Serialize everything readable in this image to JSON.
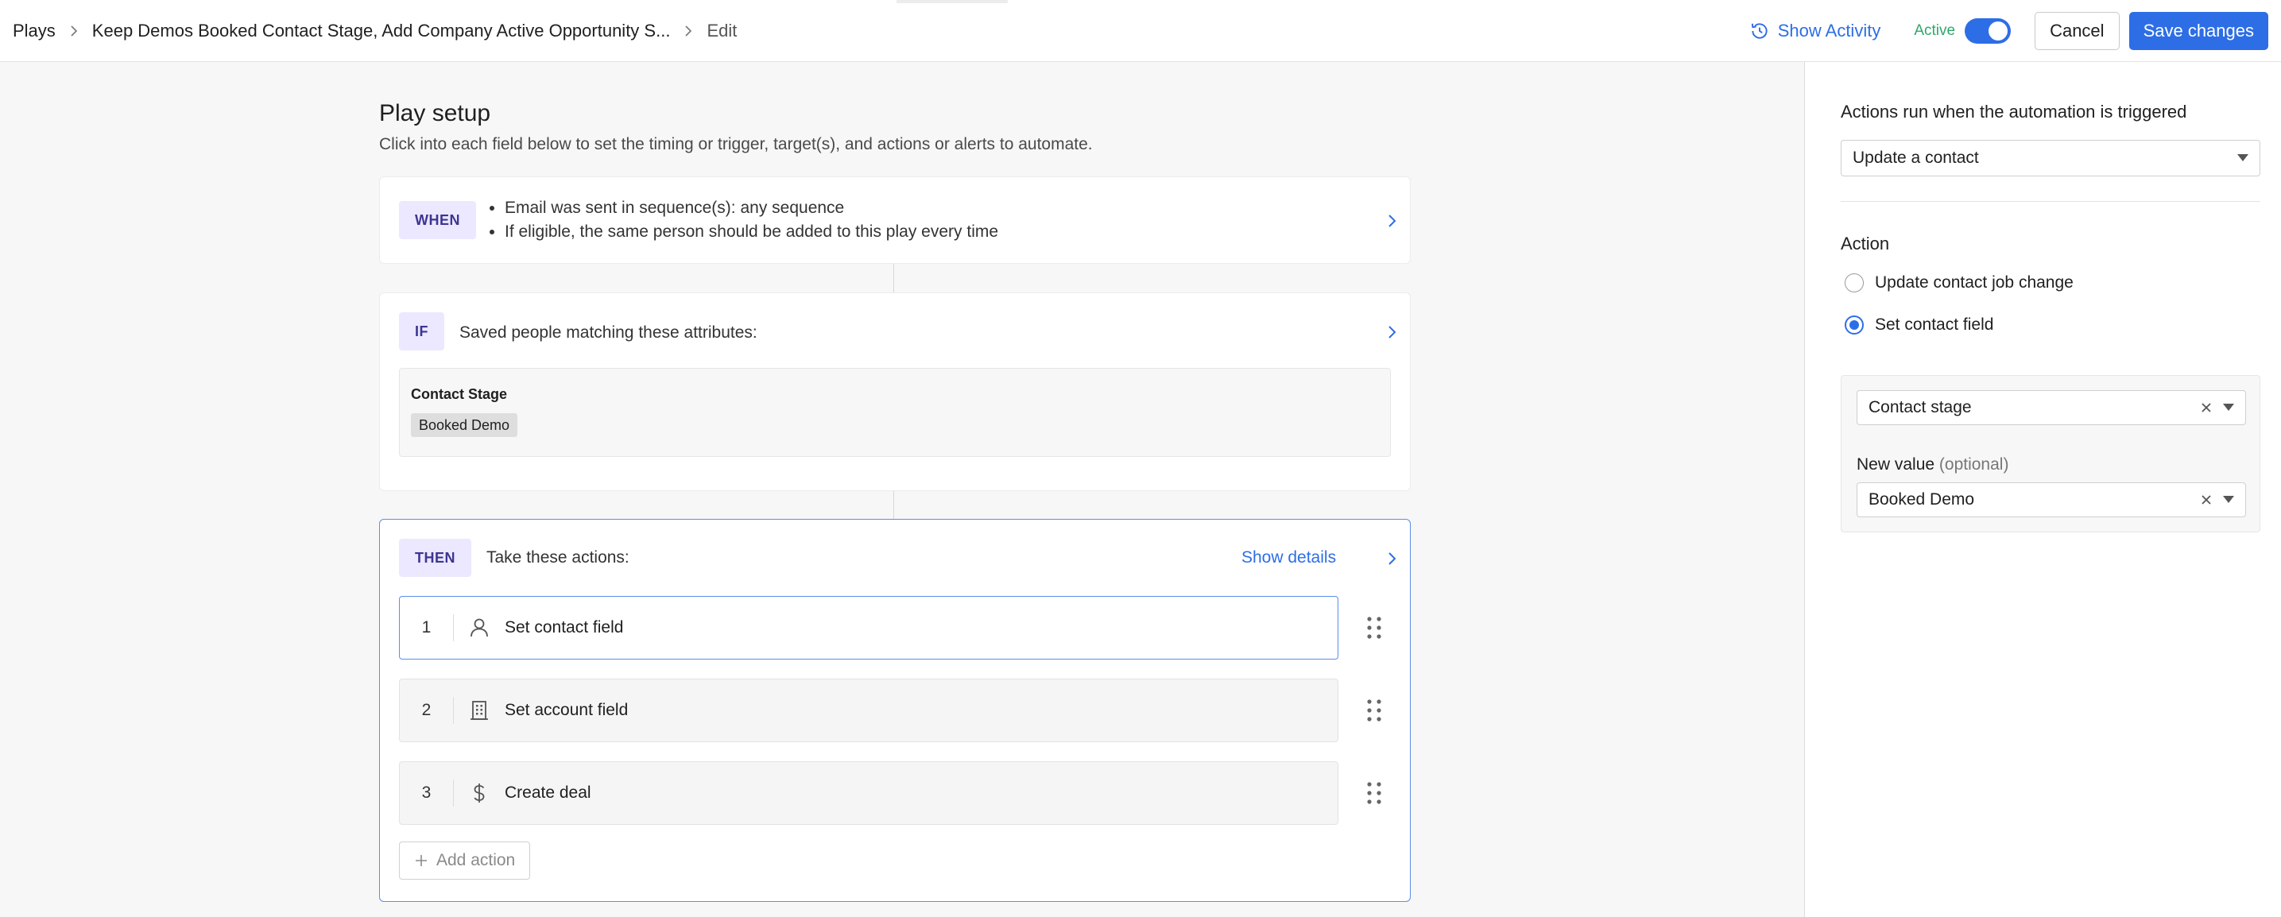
{
  "breadcrumb": {
    "root": "Plays",
    "play_name": "Keep Demos Booked Contact Stage, Add Company Active Opportunity S...",
    "current": "Edit"
  },
  "header": {
    "show_activity": "Show Activity",
    "status": "Active",
    "toggle_on": true,
    "cancel": "Cancel",
    "save": "Save changes"
  },
  "setup": {
    "title": "Play setup",
    "subtitle": "Click into each field below to set the timing or trigger, target(s), and actions or alerts to automate."
  },
  "when": {
    "tag": "WHEN",
    "items": [
      "Email was sent in sequence(s): any sequence",
      "If eligible, the same person should be added to this play every time"
    ]
  },
  "if": {
    "tag": "IF",
    "label": "Saved people matching these attributes:",
    "attribute_name": "Contact Stage",
    "attribute_value": "Booked Demo"
  },
  "then": {
    "tag": "THEN",
    "label": "Take these actions:",
    "show_details": "Show details",
    "actions": [
      {
        "num": "1",
        "label": "Set contact field",
        "icon": "person-icon",
        "selected": true
      },
      {
        "num": "2",
        "label": "Set account field",
        "icon": "building-icon",
        "selected": false
      },
      {
        "num": "3",
        "label": "Create deal",
        "icon": "dollar-icon",
        "selected": false
      }
    ],
    "add_action": "Add action"
  },
  "panel": {
    "title": "Actions run when the automation is triggered",
    "action_type": "Update a contact",
    "section_label": "Action",
    "options": [
      {
        "label": "Update contact job change",
        "checked": false
      },
      {
        "label": "Set contact field",
        "checked": true
      }
    ],
    "field": "Contact stage",
    "new_value_label": "New value",
    "new_value_optional": "(optional)",
    "new_value": "Booked Demo"
  },
  "colors": {
    "accent": "#2d6ee6",
    "active": "#2ea86b",
    "tag_bg": "#ebe8ff",
    "tag_text": "#3d3590"
  }
}
